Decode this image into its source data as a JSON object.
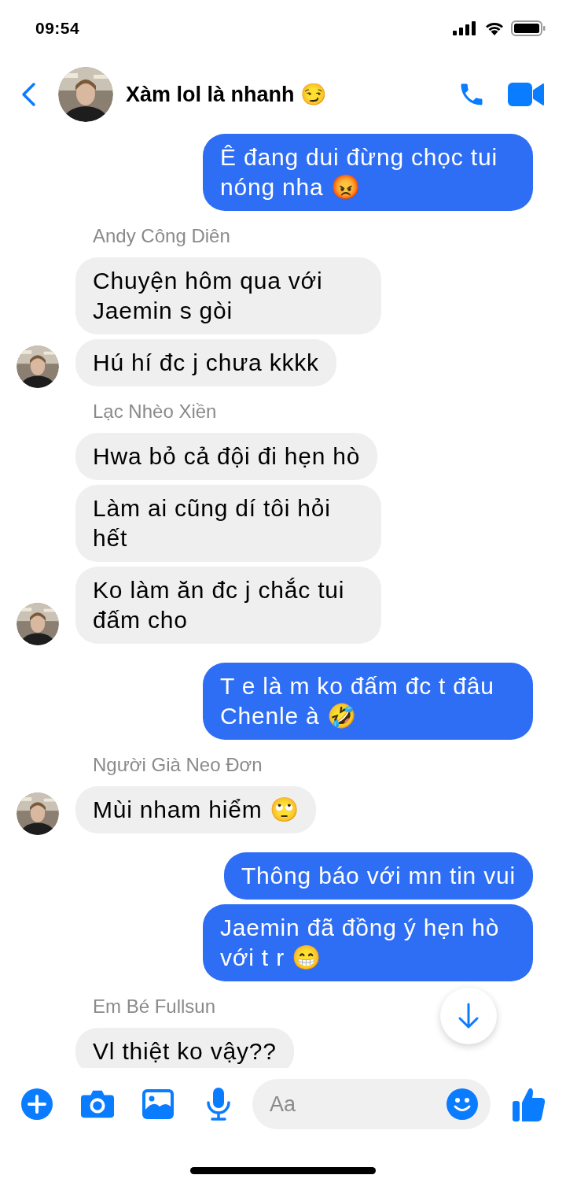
{
  "status_bar": {
    "time": "09:54"
  },
  "header": {
    "title": "Xàm lol là nhanh 😏",
    "avatar": {
      "kind": "picture"
    }
  },
  "groups": [
    {
      "kind": "outgoing",
      "messages": [
        "Ê đang dui đừng chọc tui nóng nha 😡"
      ]
    },
    {
      "kind": "incoming",
      "sender": "Andy Công Diên",
      "avatar": {
        "kind": "picture"
      },
      "messages": [
        "Chuyện hôm qua với Jaemin s gòi",
        "Hú hí đc j chưa kkkk"
      ]
    },
    {
      "kind": "incoming",
      "sender": "Lạc Nhèo Xiền",
      "avatar": {
        "kind": "picture"
      },
      "messages": [
        "Hwa bỏ cả đội đi hẹn hò",
        "Làm ai cũng dí tôi hỏi hết",
        "Ko làm ăn đc j chắc tui đấm cho"
      ]
    },
    {
      "kind": "outgoing",
      "messages": [
        "T e là m ko đấm đc t đâu Chenle à 🤣"
      ]
    },
    {
      "kind": "incoming",
      "sender": "Người Già Neo Đơn",
      "avatar": {
        "kind": "picture"
      },
      "messages": [
        "Mùi nham hiểm 🙄"
      ]
    },
    {
      "kind": "outgoing",
      "messages": [
        "Thông báo với mn tin vui",
        "Jaemin đã đồng ý hẹn hò với t r 😁"
      ]
    },
    {
      "kind": "incoming",
      "sender": "Em Bé Fullsun",
      "messages": [
        "Vl thiệt ko vậy??"
      ]
    }
  ],
  "composer": {
    "placeholder": "Aa"
  }
}
